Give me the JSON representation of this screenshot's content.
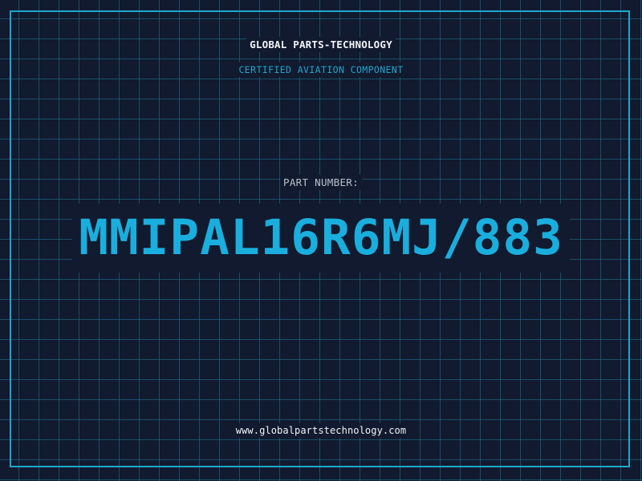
{
  "header": {
    "company_name": "GLOBAL PARTS-TECHNOLOGY",
    "tagline": "CERTIFIED AVIATION COMPONENT"
  },
  "main": {
    "part_label": "PART NUMBER:",
    "part_number": "MMIPAL16R6MJ/883"
  },
  "footer": {
    "website": "www.globalpartstechnology.com"
  },
  "colors": {
    "background": "#111a2e",
    "grid": "#2078a0",
    "accent": "#1fa6cf",
    "part_number": "#1aaede",
    "text_light": "#f2f4f7",
    "label": "#b9c0cc"
  }
}
